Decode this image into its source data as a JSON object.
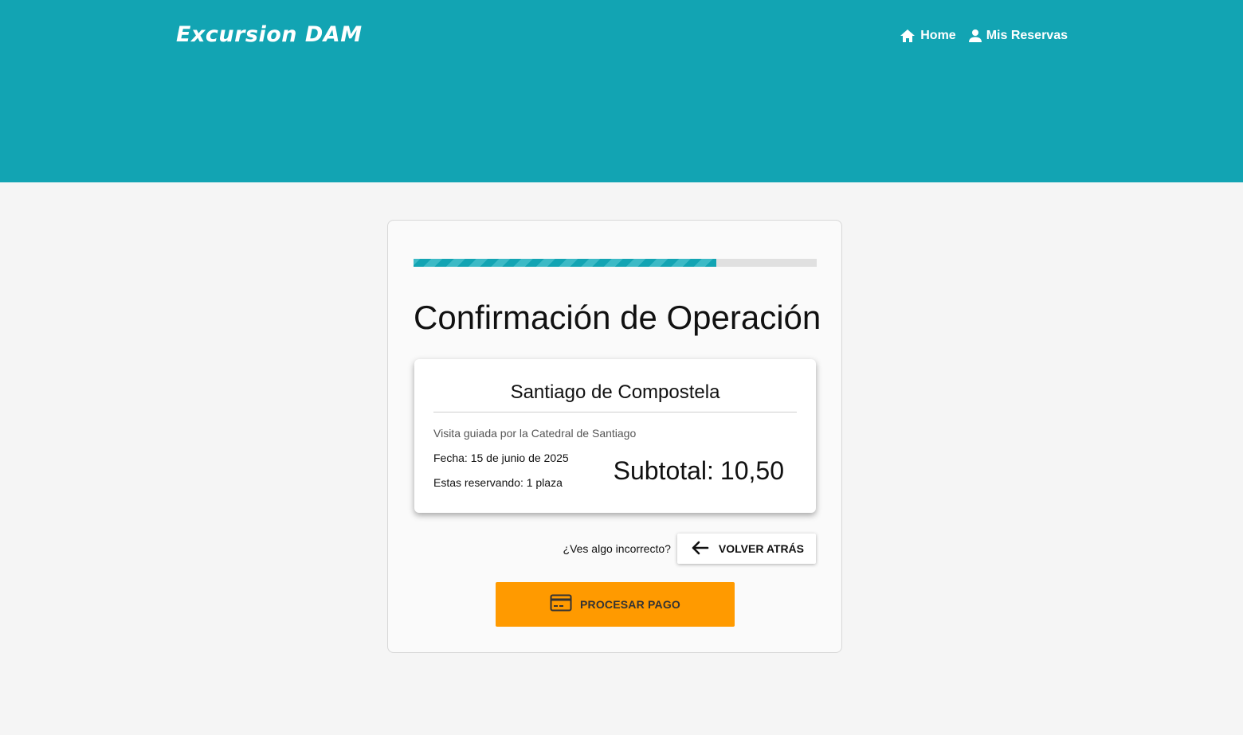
{
  "header": {
    "brand": "Excursion DAM",
    "nav": [
      {
        "label": "Home",
        "icon": "home-icon"
      },
      {
        "label": "Mis Reservas",
        "icon": "person-icon"
      }
    ],
    "background_color": "#12a4b3"
  },
  "main": {
    "progress": 0.75,
    "title": "Confirmación de Operación",
    "booking": {
      "destination": "Santiago de Compostela",
      "description": "Visita guiada por la Catedral de Santiago",
      "date": "Fecha: 15 de junio de 2025",
      "places": "Estas reservando: 1 plaza",
      "subtotal_label": "Subtotal:",
      "subtotal_value": "10,50"
    },
    "back": {
      "question": "¿Ves algo incorrecto?",
      "button_label": "VOLVER ATRÁS",
      "icon": "arrow-left-icon"
    },
    "pay": {
      "button_label": "PROCESAR PAGO",
      "icon": "credit-card-icon",
      "color": "#ff9a00"
    }
  }
}
